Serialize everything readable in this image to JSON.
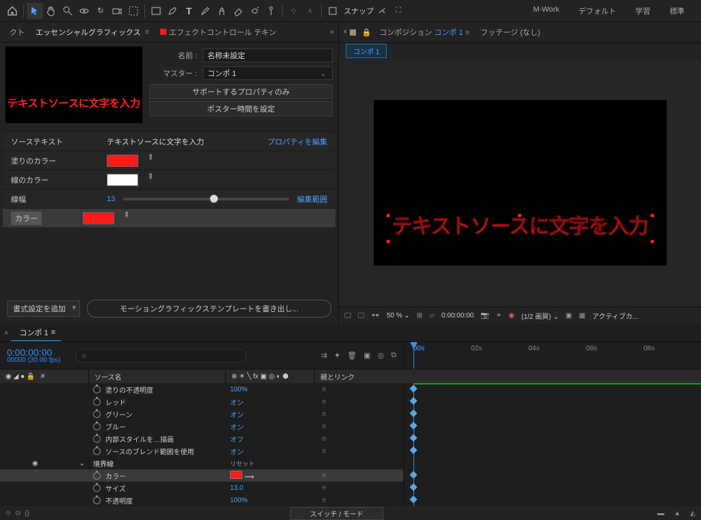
{
  "topbar": {
    "snap_label": "スナップ",
    "workspaces": [
      "M-Work",
      "デフォルト",
      "学習",
      "標準"
    ]
  },
  "left_tabs": {
    "truncated": "クト",
    "essential_graphics": "エッセンシャルグラフィックス",
    "effect_controls": "エフェクトコントロール テキン"
  },
  "preview_text": "テキストソースに文字を入力",
  "form": {
    "name_label": "名前 :",
    "name_value": "名称未設定",
    "master_label": "マスター :",
    "master_value": "コンポ 1",
    "btn_supported": "サポートするプロパティのみ",
    "btn_poster": "ポスター時間を設定"
  },
  "props": {
    "source_text_label": "ソーステキスト",
    "source_text_value": "テキストソースに文字を入力",
    "edit_props": "プロパティを編集",
    "fill_label": "塗りのカラー",
    "fill_color": "#ff1a1a",
    "stroke_label": "線のカラー",
    "stroke_color": "#ffffff",
    "stroke_width_label": "線幅",
    "stroke_width_value": "13",
    "edit_range": "編集範囲",
    "color_label": "カラー",
    "color_value": "#ff1a1a"
  },
  "footer_left": {
    "add_format": "書式設定を追加",
    "export_mogrt": "モーショングラフィックステンプレートを書き出し..."
  },
  "right_tabs": {
    "composition_prefix": "コンポジション",
    "composition_active": "コンポ 1",
    "footage": "フッテージ   (なし)",
    "subtab": "コンポ 1"
  },
  "viewer_text": "テキストソースに文字を入力",
  "viewer_bar": {
    "zoom": "50 %",
    "time": "0:00:00:00",
    "res": "(1/2 画質)",
    "active_cam": "アクティブカ..."
  },
  "timeline": {
    "tab": "コンポ 1",
    "timecode": "0:00:00:00",
    "fps": "00000 (30.00 fps)",
    "hdr_source": "ソース名",
    "hdr_parent": "親とリンク",
    "ruler": [
      "00s",
      "02s",
      "04s",
      "06s",
      "08s"
    ],
    "rows": [
      {
        "name": "塗りの不透明度",
        "value": "100%"
      },
      {
        "name": "レッド",
        "value": "オン"
      },
      {
        "name": "グリーン",
        "value": "オン"
      },
      {
        "name": "ブルー",
        "value": "オン"
      },
      {
        "name": "内部スタイルを…描画",
        "value": "オフ"
      },
      {
        "name": "ソースのブレンド範囲を使用",
        "value": "オン"
      }
    ],
    "group": "境界線",
    "reset": "リセット",
    "sub": [
      {
        "name": "カラー",
        "value": "",
        "swatch": "#ff1a1a",
        "sel": true
      },
      {
        "name": "サイズ",
        "value": "13.0"
      },
      {
        "name": "不透明度",
        "value": "100%"
      }
    ],
    "switch_mode": "スイッチ / モード"
  }
}
